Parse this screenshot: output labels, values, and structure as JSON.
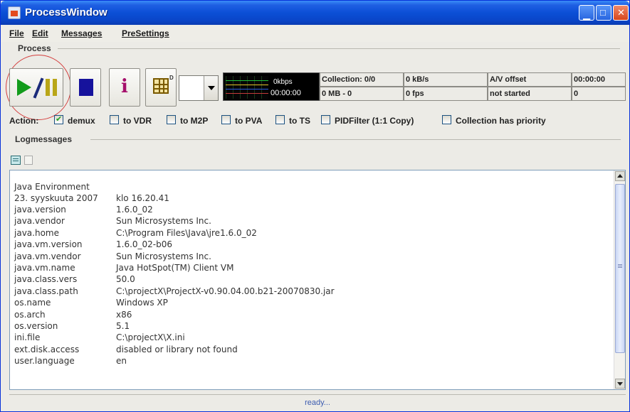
{
  "window": {
    "title": "ProcessWindow",
    "titlebar_color": "#0b4fd6"
  },
  "menu": [
    {
      "label": "File",
      "mnemonic": "F"
    },
    {
      "label": "Edit",
      "mnemonic": "E"
    },
    {
      "label": "Messages",
      "mnemonic": "M"
    },
    {
      "label": "PreSettings",
      "mnemonic": "P"
    }
  ],
  "process": {
    "section_label": "Process",
    "info_glyph": "i",
    "grid_superscript": "D",
    "monitor": {
      "rate": "0kbps",
      "time": "00:00:00"
    },
    "status": {
      "collection_label": "Collection: 0/0",
      "rate_top": "0 kB/s",
      "av_offset_label": "A/V offset",
      "av_offset_value": "00:00:00",
      "size": "0 MB - 0",
      "fps": "0 fps",
      "state": "not started",
      "count": "0"
    }
  },
  "actions": {
    "label": "Action:",
    "options": [
      {
        "label": "demux",
        "checked": true
      },
      {
        "label": "to VDR",
        "checked": false
      },
      {
        "label": "to M2P",
        "checked": false
      },
      {
        "label": "to PVA",
        "checked": false
      },
      {
        "label": "to TS",
        "checked": false
      },
      {
        "label": "PIDFilter (1:1 Copy)",
        "checked": false
      },
      {
        "label": "Collection has priority",
        "checked": false
      }
    ]
  },
  "log": {
    "section_label": "Logmessages",
    "header": "Java Environment",
    "date_line": {
      "key": "23. syyskuuta 2007",
      "value": "klo 16.20.41"
    },
    "entries": [
      {
        "key": "java.version",
        "value": "1.6.0_02"
      },
      {
        "key": "java.vendor",
        "value": "Sun Microsystems Inc."
      },
      {
        "key": "java.home",
        "value": "C:\\Program Files\\Java\\jre1.6.0_02"
      },
      {
        "key": "java.vm.version",
        "value": "1.6.0_02-b06"
      },
      {
        "key": "java.vm.vendor",
        "value": "Sun Microsystems Inc."
      },
      {
        "key": "java.vm.name",
        "value": "Java HotSpot(TM) Client VM"
      },
      {
        "key": "java.class.vers",
        "value": "50.0"
      },
      {
        "key": "java.class.path",
        "value": "C:\\projectX\\ProjectX-v0.90.04.00.b21-20070830.jar"
      },
      {
        "key": "os.name",
        "value": "Windows XP"
      },
      {
        "key": "os.arch",
        "value": "x86"
      },
      {
        "key": "os.version",
        "value": "5.1"
      },
      {
        "key": "ini.file",
        "value": "C:\\projectX\\X.ini"
      },
      {
        "key": "ext.disk.access",
        "value": "disabled or library not found"
      },
      {
        "key": "user.language",
        "value": "en"
      }
    ]
  },
  "statusbar": {
    "text": "ready..."
  }
}
